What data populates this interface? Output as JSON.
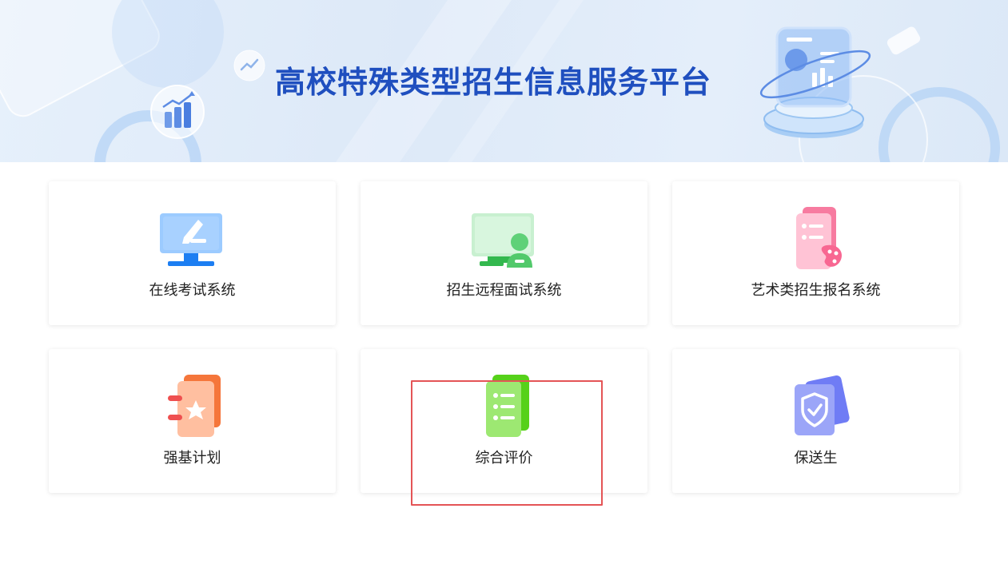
{
  "banner": {
    "title": "高校特殊类型招生信息服务平台"
  },
  "cards": [
    {
      "label": "在线考试系统",
      "icon": "monitor-pen-icon",
      "color": "#3d8ef7"
    },
    {
      "label": "招生远程面试系统",
      "icon": "monitor-user-icon",
      "color": "#3fc35a"
    },
    {
      "label": "艺术类招生报名系统",
      "icon": "document-palette-icon",
      "color": "#f5608a"
    },
    {
      "label": "强基计划",
      "icon": "notebook-star-icon",
      "color": "#f7733a"
    },
    {
      "label": "综合评价",
      "icon": "checklist-icon",
      "color": "#5ed61c"
    },
    {
      "label": "保送生",
      "icon": "shield-check-icon",
      "color": "#5b6cf5"
    }
  ],
  "highlight": {
    "color": "#e45456"
  }
}
